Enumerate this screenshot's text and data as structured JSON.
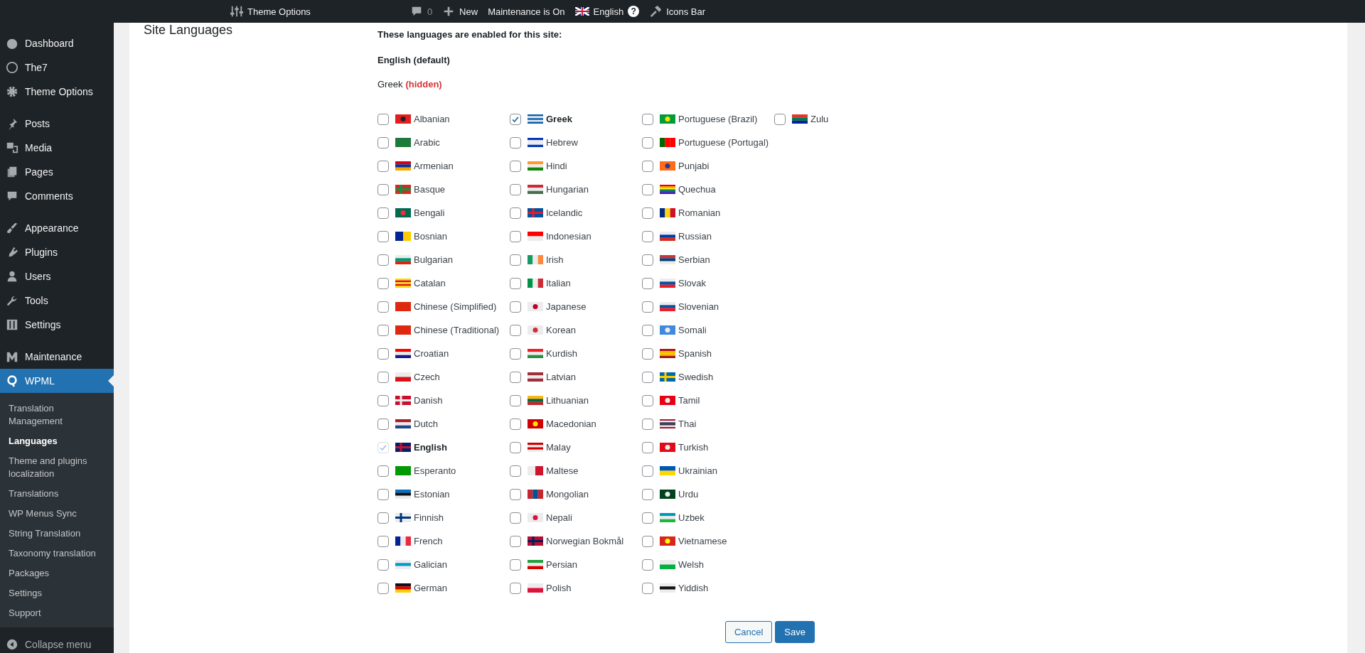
{
  "admin_bar": [
    {
      "kind": "sliders",
      "label": "Theme Options"
    },
    {
      "kind": "comment",
      "label": "0"
    },
    {
      "kind": "plus",
      "label": "New"
    },
    {
      "kind": "text",
      "label": "Maintenance is On"
    },
    {
      "kind": "language",
      "label": "English",
      "badge": "?"
    },
    {
      "kind": "hammer",
      "label": "Icons Bar"
    }
  ],
  "sidebar": {
    "groups": [
      [
        {
          "label": "Dashboard",
          "selected": false
        },
        {
          "label": "The7",
          "selected": false
        },
        {
          "label": "Theme Options",
          "selected": false
        }
      ],
      [
        {
          "label": "Posts",
          "selected": false
        },
        {
          "label": "Media",
          "selected": false
        },
        {
          "label": "Pages",
          "selected": false
        },
        {
          "label": "Comments",
          "selected": false
        }
      ],
      [
        {
          "label": "Appearance",
          "selected": false
        },
        {
          "label": "Plugins",
          "selected": false
        },
        {
          "label": "Users",
          "selected": false
        },
        {
          "label": "Tools",
          "selected": false
        },
        {
          "label": "Settings",
          "selected": false
        }
      ],
      [
        {
          "label": "Maintenance",
          "selected": false
        },
        {
          "label": "WPML",
          "selected": true,
          "submenu": [
            {
              "label": "Translation Management",
              "selected": false
            },
            {
              "label": "Languages",
              "selected": true
            },
            {
              "label": "Theme and plugins localization",
              "selected": false
            },
            {
              "label": "Translations",
              "selected": false
            },
            {
              "label": "WP Menus Sync",
              "selected": false
            },
            {
              "label": "String Translation",
              "selected": false
            },
            {
              "label": "Taxonomy translation",
              "selected": false
            },
            {
              "label": "Packages",
              "selected": false
            },
            {
              "label": "Settings",
              "selected": false
            },
            {
              "label": "Support",
              "selected": false
            }
          ]
        }
      ]
    ],
    "collapse": {
      "label": "Collapse menu"
    }
  },
  "section": {
    "title": "Site Languages",
    "intro": "These languages are enabled for this site:",
    "enabled": [
      {
        "kind": "default",
        "text": "English (default)"
      },
      {
        "kind": "hidden",
        "text": "Greek",
        "note": "(hidden)"
      }
    ],
    "languages": [
      {
        "label": "Albanian",
        "checked": false,
        "disabled": false
      },
      {
        "label": "Arabic",
        "checked": false,
        "disabled": false
      },
      {
        "label": "Armenian",
        "checked": false,
        "disabled": false
      },
      {
        "label": "Basque",
        "checked": false,
        "disabled": false
      },
      {
        "label": "Bengali",
        "checked": false,
        "disabled": false
      },
      {
        "label": "Bosnian",
        "checked": false,
        "disabled": false
      },
      {
        "label": "Bulgarian",
        "checked": false,
        "disabled": false
      },
      {
        "label": "Catalan",
        "checked": false,
        "disabled": false
      },
      {
        "label": "Chinese (Simplified)",
        "checked": false,
        "disabled": false
      },
      {
        "label": "Chinese (Traditional)",
        "checked": false,
        "disabled": false
      },
      {
        "label": "Croatian",
        "checked": false,
        "disabled": false
      },
      {
        "label": "Czech",
        "checked": false,
        "disabled": false
      },
      {
        "label": "Danish",
        "checked": false,
        "disabled": false
      },
      {
        "label": "Dutch",
        "checked": false,
        "disabled": false
      },
      {
        "label": "English",
        "checked": true,
        "disabled": true
      },
      {
        "label": "Esperanto",
        "checked": false,
        "disabled": false
      },
      {
        "label": "Estonian",
        "checked": false,
        "disabled": false
      },
      {
        "label": "Finnish",
        "checked": false,
        "disabled": false
      },
      {
        "label": "French",
        "checked": false,
        "disabled": false
      },
      {
        "label": "Galician",
        "checked": false,
        "disabled": false
      },
      {
        "label": "German",
        "checked": false,
        "disabled": false
      },
      {
        "label": "Greek",
        "checked": true,
        "disabled": false
      },
      {
        "label": "Hebrew",
        "checked": false,
        "disabled": false
      },
      {
        "label": "Hindi",
        "checked": false,
        "disabled": false
      },
      {
        "label": "Hungarian",
        "checked": false,
        "disabled": false
      },
      {
        "label": "Icelandic",
        "checked": false,
        "disabled": false
      },
      {
        "label": "Indonesian",
        "checked": false,
        "disabled": false
      },
      {
        "label": "Irish",
        "checked": false,
        "disabled": false
      },
      {
        "label": "Italian",
        "checked": false,
        "disabled": false
      },
      {
        "label": "Japanese",
        "checked": false,
        "disabled": false
      },
      {
        "label": "Korean",
        "checked": false,
        "disabled": false
      },
      {
        "label": "Kurdish",
        "checked": false,
        "disabled": false
      },
      {
        "label": "Latvian",
        "checked": false,
        "disabled": false
      },
      {
        "label": "Lithuanian",
        "checked": false,
        "disabled": false
      },
      {
        "label": "Macedonian",
        "checked": false,
        "disabled": false
      },
      {
        "label": "Malay",
        "checked": false,
        "disabled": false
      },
      {
        "label": "Maltese",
        "checked": false,
        "disabled": false
      },
      {
        "label": "Mongolian",
        "checked": false,
        "disabled": false
      },
      {
        "label": "Nepali",
        "checked": false,
        "disabled": false
      },
      {
        "label": "Norwegian Bokmål",
        "checked": false,
        "disabled": false
      },
      {
        "label": "Persian",
        "checked": false,
        "disabled": false
      },
      {
        "label": "Polish",
        "checked": false,
        "disabled": false
      },
      {
        "label": "Portuguese (Brazil)",
        "checked": false,
        "disabled": false
      },
      {
        "label": "Portuguese (Portugal)",
        "checked": false,
        "disabled": false
      },
      {
        "label": "Punjabi",
        "checked": false,
        "disabled": false
      },
      {
        "label": "Quechua",
        "checked": false,
        "disabled": false
      },
      {
        "label": "Romanian",
        "checked": false,
        "disabled": false
      },
      {
        "label": "Russian",
        "checked": false,
        "disabled": false
      },
      {
        "label": "Serbian",
        "checked": false,
        "disabled": false
      },
      {
        "label": "Slovak",
        "checked": false,
        "disabled": false
      },
      {
        "label": "Slovenian",
        "checked": false,
        "disabled": false
      },
      {
        "label": "Somali",
        "checked": false,
        "disabled": false
      },
      {
        "label": "Spanish",
        "checked": false,
        "disabled": false
      },
      {
        "label": "Swedish",
        "checked": false,
        "disabled": false
      },
      {
        "label": "Tamil",
        "checked": false,
        "disabled": false
      },
      {
        "label": "Thai",
        "checked": false,
        "disabled": false
      },
      {
        "label": "Turkish",
        "checked": false,
        "disabled": false
      },
      {
        "label": "Ukrainian",
        "checked": false,
        "disabled": false
      },
      {
        "label": "Urdu",
        "checked": false,
        "disabled": false
      },
      {
        "label": "Uzbek",
        "checked": false,
        "disabled": false
      },
      {
        "label": "Vietnamese",
        "checked": false,
        "disabled": false
      },
      {
        "label": "Welsh",
        "checked": false,
        "disabled": false
      },
      {
        "label": "Yiddish",
        "checked": false,
        "disabled": false
      },
      {
        "label": "Zulu",
        "checked": false,
        "disabled": false
      }
    ],
    "buttons": [
      {
        "kind": "secondary",
        "label": "Cancel"
      },
      {
        "kind": "primary",
        "label": "Save"
      }
    ]
  }
}
